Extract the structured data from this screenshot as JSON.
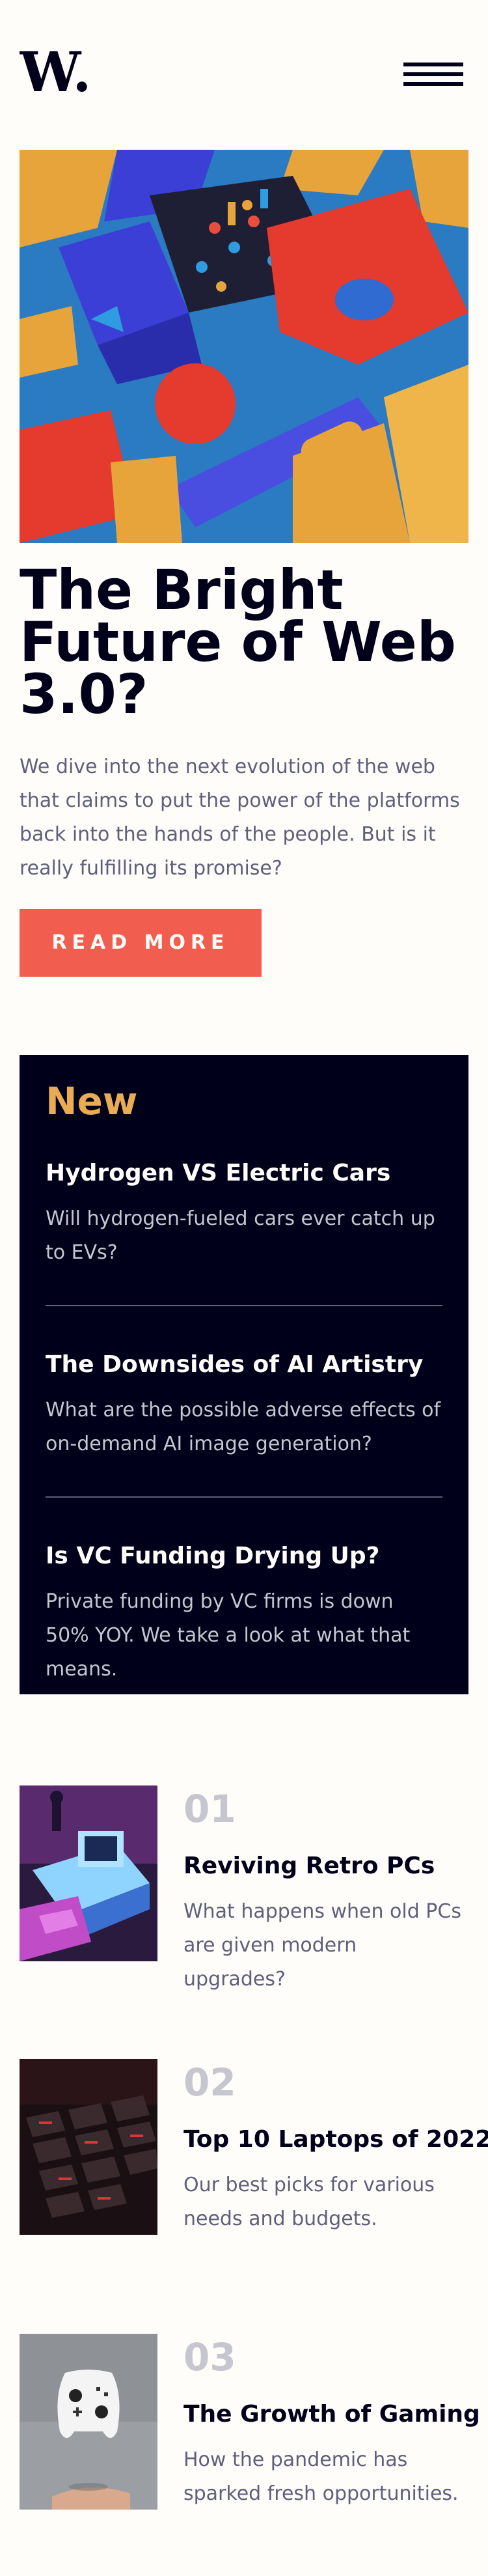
{
  "header": {
    "logo_text": "W.",
    "menu_icon": "hamburger-menu-icon"
  },
  "hero": {
    "image_icon": "abstract-3d-shapes-image",
    "title": "The Bright Future of Web 3.0?",
    "description": "We dive into the next evolution of the web that claims to put the power of the platforms back into the hands of the people. But is it really fulfilling its promise?",
    "button_label": "READ MORE"
  },
  "new_panel": {
    "heading": "New",
    "items": [
      {
        "title": "Hydrogen VS Electric Cars",
        "description": "Will hydrogen-fueled cars ever catch up to EVs?"
      },
      {
        "title": "The Downsides of AI Artistry",
        "description": "What are the possible adverse effects of on-demand AI image generation?"
      },
      {
        "title": "Is VC Funding Drying Up?",
        "description": "Private funding by VC firms is down 50% YOY. We take a look at what that means."
      }
    ]
  },
  "trending": [
    {
      "number": "01",
      "title": "Reviving Retro PCs",
      "description": "What happens when old PCs are given modern upgrades?",
      "image_icon": "retro-pc-image"
    },
    {
      "number": "02",
      "title": "Top 10 Laptops of 2022",
      "description": "Our best picks for various needs and budgets.",
      "image_icon": "laptop-keyboard-image"
    },
    {
      "number": "03",
      "title": "The Growth of Gaming",
      "description": "How the pandemic has sparked fresh opportunities.",
      "image_icon": "game-controller-image"
    }
  ],
  "colors": {
    "soft_orange": "#e9ab53",
    "soft_red": "#f15e50",
    "off_white": "#fffdfa",
    "grayish_blue": "#c5c6ce",
    "dark_grayish_blue": "#5e607a",
    "very_dark_blue": "#00001a"
  }
}
